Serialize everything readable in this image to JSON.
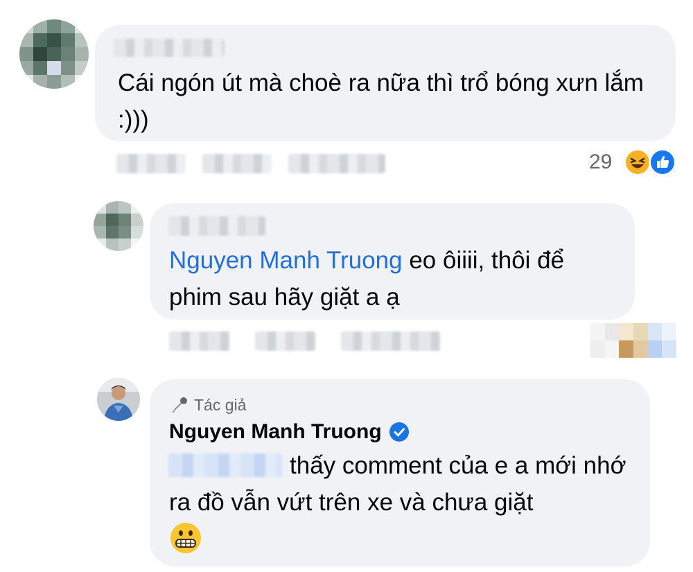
{
  "comment1": {
    "text": "Cái ngón út mà choè ra nữa thì trổ bóng xưn lắm :)))",
    "reaction_count": "29",
    "reaction_icons": [
      "haha-icon",
      "like-icon"
    ]
  },
  "reply1": {
    "mention": "Nguyen Manh Truong",
    "text": " eo ôiiii, thôi để phim sau hãy giặt a ạ"
  },
  "reply2": {
    "badge": "Tác giả",
    "author": "Nguyen Manh Truong",
    "text": "thấy comment của e a mới nhớ ra đồ vẫn vứt trên xe và chưa giặt",
    "emoji": "😬"
  },
  "colors": {
    "bubble": "#f0f2f5",
    "mention": "#216fdb",
    "verified": "#1b74e4",
    "meta": "#65676b"
  }
}
